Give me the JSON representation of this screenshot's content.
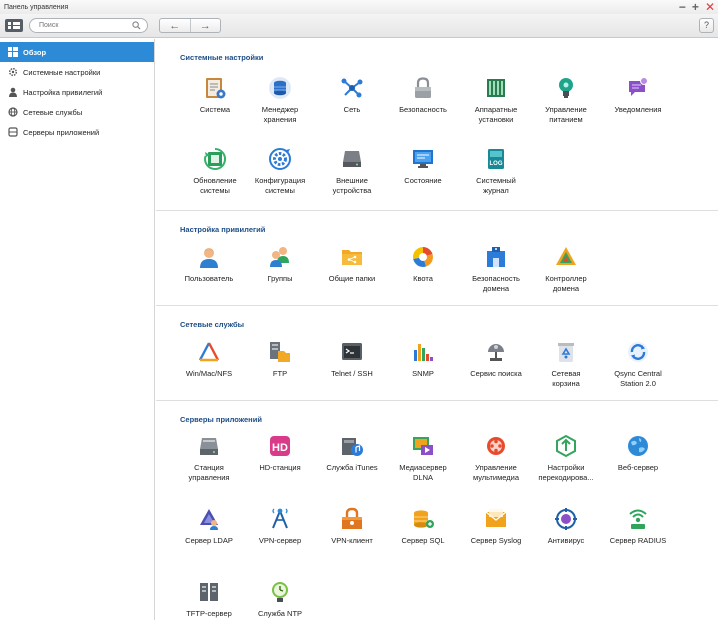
{
  "window": {
    "title": "Панель управления"
  },
  "toolbar": {
    "search_placeholder": "Поиск",
    "help": "?"
  },
  "sidebar": {
    "items": [
      {
        "label": "Обзор",
        "active": true
      },
      {
        "label": "Системные настройки"
      },
      {
        "label": "Настройка привилегий"
      },
      {
        "label": "Сетевые службы"
      },
      {
        "label": "Серверы приложений"
      }
    ]
  },
  "sections": [
    {
      "title": "Системные настройки",
      "tiles": [
        {
          "label": "Система",
          "icon": "system-icon"
        },
        {
          "label": "Менеджер\nхранения",
          "icon": "storage-icon"
        },
        {
          "label": "Сеть",
          "icon": "network-icon"
        },
        {
          "label": "Безопасность",
          "icon": "lock-icon"
        },
        {
          "label": "Аппаратные\nустановки",
          "icon": "hardware-icon"
        },
        {
          "label": "Управление\nпитанием",
          "icon": "power-icon"
        },
        {
          "label": "Уведомления",
          "icon": "notification-icon"
        },
        {
          "label": "Обновление\nсистемы",
          "icon": "update-icon"
        },
        {
          "label": "Конфигурация\nсистемы",
          "icon": "config-icon"
        },
        {
          "label": "Внешние\nустройства",
          "icon": "external-device-icon"
        },
        {
          "label": "Состояние",
          "icon": "status-icon"
        },
        {
          "label": "Системный\nжурнал",
          "icon": "log-icon"
        }
      ]
    },
    {
      "title": "Настройка привилегий",
      "tiles": [
        {
          "label": "Пользователь",
          "icon": "user-icon"
        },
        {
          "label": "Группы",
          "icon": "groups-icon"
        },
        {
          "label": "Общие папки",
          "icon": "shared-folder-icon"
        },
        {
          "label": "Квота",
          "icon": "quota-icon"
        },
        {
          "label": "Безопасность\nдомена",
          "icon": "domain-security-icon"
        },
        {
          "label": "Контроллер\nдомена",
          "icon": "domain-controller-icon"
        }
      ]
    },
    {
      "title": "Сетевые службы",
      "tiles": [
        {
          "label": "Win/Mac/NFS",
          "icon": "win-mac-nfs-icon"
        },
        {
          "label": "FTP",
          "icon": "ftp-icon"
        },
        {
          "label": "Telnet / SSH",
          "icon": "terminal-icon"
        },
        {
          "label": "SNMP",
          "icon": "snmp-icon"
        },
        {
          "label": "Сервис поиска",
          "icon": "discovery-icon"
        },
        {
          "label": "Сетевая\nкорзина",
          "icon": "recycle-bin-icon"
        },
        {
          "label": "Qsync Central\nStation 2.0",
          "icon": "qsync-icon"
        }
      ]
    },
    {
      "title": "Серверы приложений",
      "tiles": [
        {
          "label": "Станция\nуправления",
          "icon": "station-icon"
        },
        {
          "label": "HD-станция",
          "icon": "hd-station-icon"
        },
        {
          "label": "Служба iTunes",
          "icon": "itunes-icon"
        },
        {
          "label": "Медиасервер\nDLNA",
          "icon": "dlna-icon"
        },
        {
          "label": "Управление\nмультимедиа",
          "icon": "multimedia-icon"
        },
        {
          "label": "Настройки\nперекодирова...",
          "icon": "transcode-icon"
        },
        {
          "label": "Веб-сервер",
          "icon": "web-server-icon"
        },
        {
          "label": "Сервер LDAP",
          "icon": "ldap-icon"
        },
        {
          "label": "VPN-сервер",
          "icon": "vpn-server-icon"
        },
        {
          "label": "VPN-клиент",
          "icon": "vpn-client-icon"
        },
        {
          "label": "Сервер SQL",
          "icon": "sql-icon"
        },
        {
          "label": "Сервер Syslog",
          "icon": "syslog-icon"
        },
        {
          "label": "Антивирус",
          "icon": "antivirus-icon"
        },
        {
          "label": "Сервер RADIUS",
          "icon": "radius-icon"
        },
        {
          "label": "TFTP-сервер",
          "icon": "tftp-icon"
        },
        {
          "label": "Служба NTP",
          "icon": "ntp-icon"
        }
      ]
    }
  ]
}
